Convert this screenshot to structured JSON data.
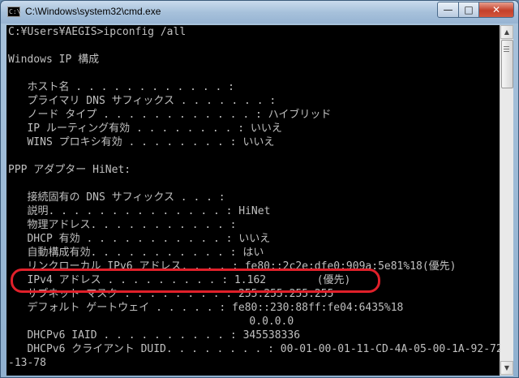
{
  "window": {
    "title": "C:\\Windows\\system32\\cmd.exe",
    "app_icon": "C:\\",
    "controls": {
      "minimize": "—",
      "maximize": "□",
      "close": "✕"
    }
  },
  "console": {
    "lines": [
      "C:¥Users¥AEGIS>ipconfig /all",
      "",
      "Windows IP 構成",
      "",
      "   ホスト名 . . . . . . . . . . . . :",
      "   プライマリ DNS サフィックス . . . . . . . :",
      "   ノード タイプ . . . . . . . . . . . . : ハイブリッド",
      "   IP ルーティング有効 . . . . . . . . : いいえ",
      "   WINS プロキシ有効 . . . . . . . . : いいえ",
      "",
      "PPP アダプター HiNet:",
      "",
      "   接続固有の DNS サフィックス . . . :",
      "   説明. . . . . . . . . . . . . . : HiNet",
      "   物理アドレス. . . . . . . . . . . :",
      "   DHCP 有効 . . . . . . . . . . . : いいえ",
      "   自動構成有効. . . . . . . . . . . : はい",
      "   リンクローカル IPv6 アドレス. . . . : fe80::2c2e:dfe0:909a:5e81%18(優先)",
      "   IPv4 アドレス . . . . . . . . . : 1.162        (優先)",
      "   サブネット マスク . . . . . . . . : 255.255.255.255",
      "   デフォルト ゲートウェイ . . . . . : fe80::230:88ff:fe04:6435%18",
      "                                      0.0.0.0",
      "   DHCPv6 IAID . . . . . . . . . . : 345538336",
      "   DHCPv6 クライアント DUID. . . . . . . . : 00-01-00-01-11-CD-4A-05-00-1A-92-72",
      "-13-78"
    ]
  },
  "scrollbar": {
    "up_arrow": "▲",
    "down_arrow": "▼"
  }
}
